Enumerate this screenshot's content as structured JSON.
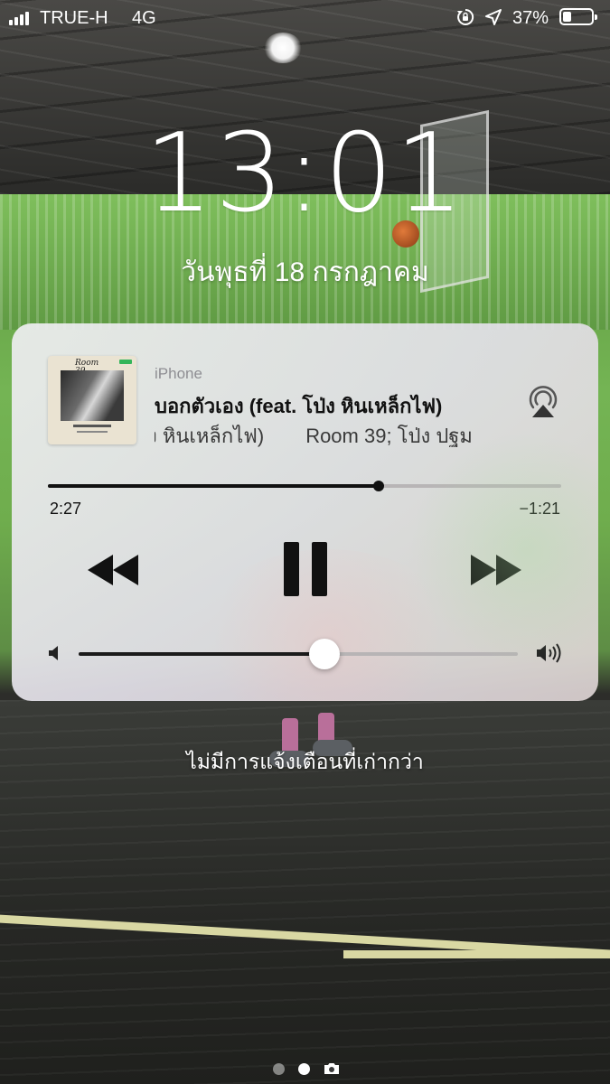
{
  "status_bar": {
    "carrier": "TRUE-H",
    "network": "4G",
    "battery_percent": "37%",
    "battery_level": 0.37,
    "icons": [
      "signal-bars-icon",
      "rotation-lock-icon",
      "location-arrow-icon",
      "battery-icon"
    ]
  },
  "lock_screen": {
    "time": "13:01",
    "date": "วันพุธที่ 18 กรกฎาคม",
    "no_older_notifications": "ไม่มีการแจ้งเตือนที่เก่ากว่า"
  },
  "now_playing": {
    "source_device": "iPhone",
    "title": "บอกตัวเอง (feat. โป่ง หินเหล็กไฟ)",
    "subtitle_scrolling": "ง หินเหล็กไฟ)",
    "subtitle_next": "Room 39; โป่ง ปฐม",
    "album_art_title": "ROOM 39",
    "elapsed": "2:27",
    "remaining": "−1:21",
    "progress": 0.645,
    "volume": 0.56,
    "controls": [
      "rewind-icon",
      "pause-icon",
      "fast-forward-icon"
    ],
    "airplay_icon": "airplay-icon"
  },
  "pager": {
    "pages": 2,
    "active_page": 2,
    "camera_icon": "camera-icon"
  },
  "colors": {
    "card_bg": "#ececee",
    "progress_fill": "#111111",
    "track": "#b8b5b6"
  }
}
